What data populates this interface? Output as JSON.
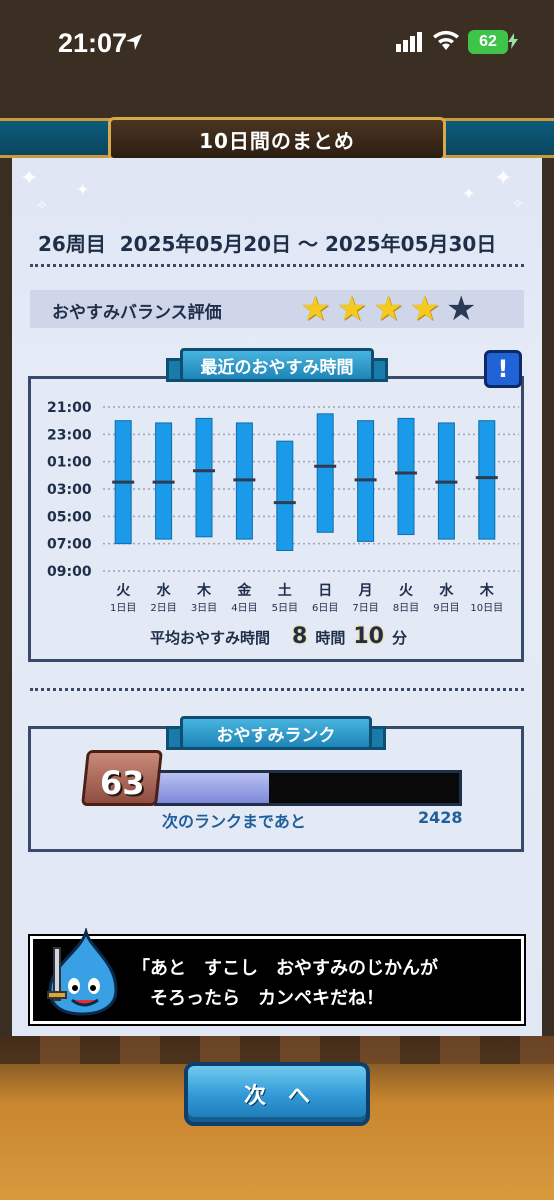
{
  "status_bar": {
    "time": "21:07",
    "battery": "62"
  },
  "header": {
    "title": "10日間のまとめ"
  },
  "summary": {
    "period": "26周目  2025年05月20日 ～ 2025年05月30日",
    "balance_label": "おやすみバランス評価",
    "stars_rating": 4,
    "stars_max": 5
  },
  "sleep_section": {
    "title": "最近のおやすみ時間",
    "info_label": "!",
    "avg_label": "平均おやすみ時間",
    "avg_hours": "8",
    "avg_hours_unit": "時間",
    "avg_minutes": "10",
    "avg_minutes_unit": "分"
  },
  "chart_data": {
    "type": "bar",
    "y_ticks": [
      "21:00",
      "23:00",
      "01:00",
      "03:00",
      "05:00",
      "07:00",
      "09:00"
    ],
    "ylim_hours_since_21": [
      0,
      12
    ],
    "categories": [
      {
        "weekday": "火",
        "day": "1日目"
      },
      {
        "weekday": "水",
        "day": "2日目"
      },
      {
        "weekday": "木",
        "day": "3日目"
      },
      {
        "weekday": "金",
        "day": "4日目"
      },
      {
        "weekday": "土",
        "day": "5日目"
      },
      {
        "weekday": "日",
        "day": "6日目"
      },
      {
        "weekday": "月",
        "day": "7日目"
      },
      {
        "weekday": "火",
        "day": "8日目"
      },
      {
        "weekday": "水",
        "day": "9日目"
      },
      {
        "weekday": "木",
        "day": "10日目"
      }
    ],
    "sleep_start": [
      "22:00",
      "22:10",
      "21:50",
      "22:10",
      "23:30",
      "21:30",
      "22:00",
      "21:50",
      "22:10",
      "22:00"
    ],
    "wake": [
      "07:00",
      "06:40",
      "06:30",
      "06:40",
      "07:30",
      "06:10",
      "06:50",
      "06:20",
      "06:40",
      "06:40"
    ],
    "midpoint": [
      "02:30",
      "02:30",
      "01:40",
      "02:20",
      "04:00",
      "01:20",
      "02:20",
      "01:50",
      "02:30",
      "02:10"
    ],
    "colors": {
      "bar": "#1a9ae8",
      "midline": "#2f3b4f",
      "grid": "#9aa4bb"
    }
  },
  "rank_section": {
    "title": "おやすみランク",
    "rank": "63",
    "progress": 0.37,
    "next_label": "次のランクまであと",
    "next_value": "2428"
  },
  "message": {
    "text": "「あと　すこし　おやすみのじかんが\n　そろったら　カンペキだね！"
  },
  "footer": {
    "next_button": "次　へ"
  }
}
